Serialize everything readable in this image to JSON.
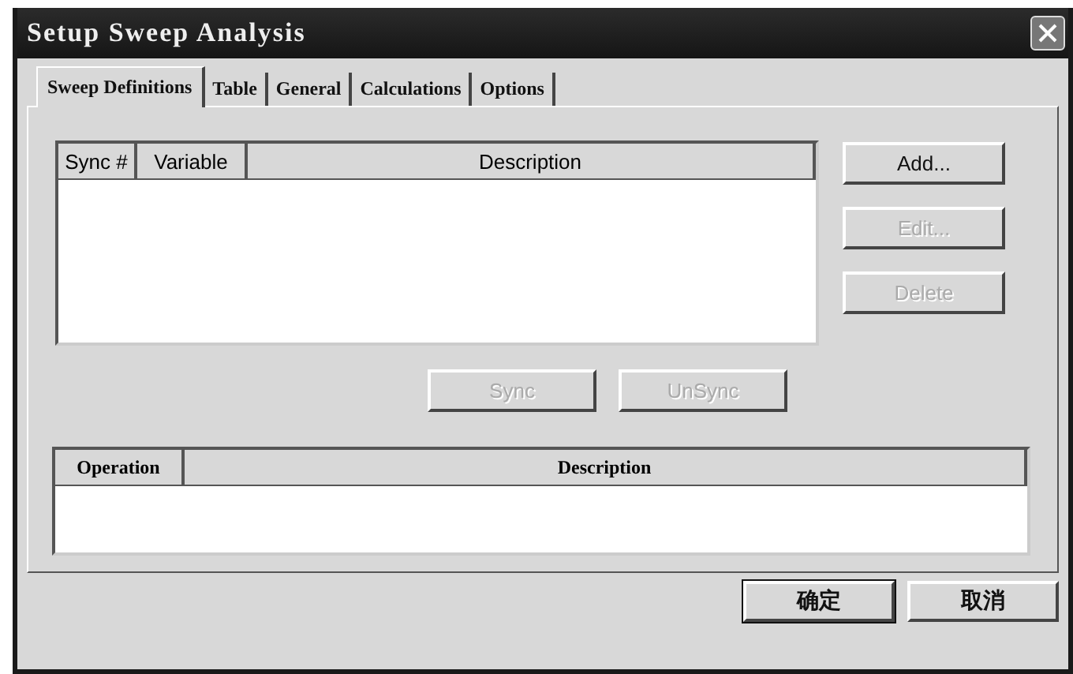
{
  "window": {
    "title": "Setup Sweep Analysis"
  },
  "tabs": [
    {
      "label": "Sweep Definitions",
      "selected": true
    },
    {
      "label": "Table",
      "selected": false
    },
    {
      "label": "General",
      "selected": false
    },
    {
      "label": "Calculations",
      "selected": false
    },
    {
      "label": "Options",
      "selected": false
    }
  ],
  "sweep_table": {
    "columns": [
      "Sync #",
      "Variable",
      "Description"
    ]
  },
  "side_buttons": [
    {
      "label": "Add...",
      "disabled": false
    },
    {
      "label": "Edit...",
      "disabled": true
    },
    {
      "label": "Delete",
      "disabled": true
    }
  ],
  "sync_buttons": [
    {
      "label": "Sync",
      "disabled": true
    },
    {
      "label": "UnSync",
      "disabled": true
    }
  ],
  "operation_table": {
    "columns": [
      "Operation",
      "Description"
    ]
  },
  "dialog_buttons": [
    {
      "label": "确定",
      "default": true
    },
    {
      "label": "取消",
      "default": false
    }
  ]
}
